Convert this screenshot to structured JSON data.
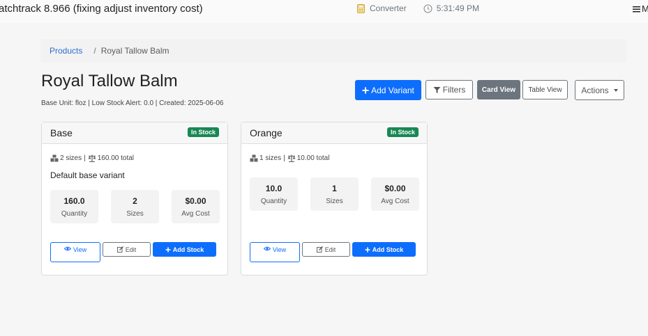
{
  "topbar": {
    "app_title": "atchtrack 8.966 (fixing adjust inventory cost)",
    "converter_label": "Converter",
    "time": "5:31:49 PM",
    "menu_label": "M"
  },
  "breadcrumb": {
    "products_link": "Products",
    "separator": "/",
    "current": "Royal Tallow Balm"
  },
  "page": {
    "title": "Royal Tallow Balm",
    "meta": "Base Unit: floz | Low Stock Alert: 0.0 | Created: 2025-06-06"
  },
  "toolbar": {
    "add_variant": "Add Variant",
    "filters": "Filters",
    "card_view": "Card View",
    "table_view": "Table View",
    "actions": "Actions"
  },
  "colors": {
    "primary": "#0d6efd",
    "secondary": "#6c757d",
    "success": "#198754"
  },
  "variants": [
    {
      "name": "Base",
      "badge": "In Stock",
      "sizes_text": "2 sizes",
      "separator": "|",
      "total_text": "160.00 total",
      "description": "Default base variant",
      "stats": [
        {
          "value": "160.0",
          "label": "Quantity"
        },
        {
          "value": "2",
          "label": "Sizes"
        },
        {
          "value": "$0.00",
          "label": "Avg Cost"
        }
      ],
      "actions": {
        "view": "View",
        "edit": "Edit",
        "add_stock": "Add Stock"
      }
    },
    {
      "name": "Orange",
      "badge": "In Stock",
      "sizes_text": "1 sizes",
      "separator": "|",
      "total_text": "10.00 total",
      "description": "",
      "stats": [
        {
          "value": "10.0",
          "label": "Quantity"
        },
        {
          "value": "1",
          "label": "Sizes"
        },
        {
          "value": "$0.00",
          "label": "Avg Cost"
        }
      ],
      "actions": {
        "view": "View",
        "edit": "Edit",
        "add_stock": "Add Stock"
      }
    }
  ]
}
